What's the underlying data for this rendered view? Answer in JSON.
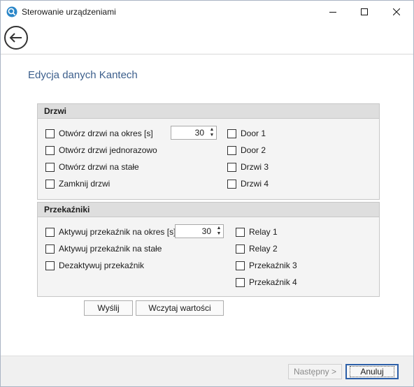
{
  "window": {
    "title": "Sterowanie urządzeniami",
    "minimize_glyph": "—",
    "maximize_glyph": "☐",
    "close_glyph": "✕"
  },
  "page_title": "Edycja danych Kantech",
  "doors_group": {
    "title": "Drzwi",
    "actions": [
      {
        "label": "Otwórz drzwi na okres [s]",
        "checked": false
      },
      {
        "label": "Otwórz drzwi jednorazowo",
        "checked": false
      },
      {
        "label": "Otwórz drzwi na stałe",
        "checked": false
      },
      {
        "label": "Zamknij drzwi",
        "checked": false
      }
    ],
    "period_value": "30",
    "targets": [
      {
        "label": "Door 1",
        "checked": false
      },
      {
        "label": "Door 2",
        "checked": false
      },
      {
        "label": "Drzwi 3",
        "checked": false
      },
      {
        "label": "Drzwi 4",
        "checked": false
      }
    ]
  },
  "relays_group": {
    "title": "Przekaźniki",
    "actions": [
      {
        "label": "Aktywuj przekaźnik na okres [s]",
        "checked": false
      },
      {
        "label": "Aktywuj przekaźnik na stałe",
        "checked": false
      },
      {
        "label": "Dezaktywuj przekaźnik",
        "checked": false
      }
    ],
    "period_value": "30",
    "targets": [
      {
        "label": "Relay 1",
        "checked": false
      },
      {
        "label": "Relay 2",
        "checked": false
      },
      {
        "label": "Przekaźnik 3",
        "checked": false
      },
      {
        "label": "Przekaźnik 4",
        "checked": false
      }
    ]
  },
  "buttons": {
    "send": "Wyślij",
    "load_values": "Wczytaj wartości",
    "next": "Następny >",
    "cancel": "Anuluj"
  },
  "colors": {
    "title_accent": "#3c5f8c",
    "default_button_border": "#2c5fa8"
  }
}
